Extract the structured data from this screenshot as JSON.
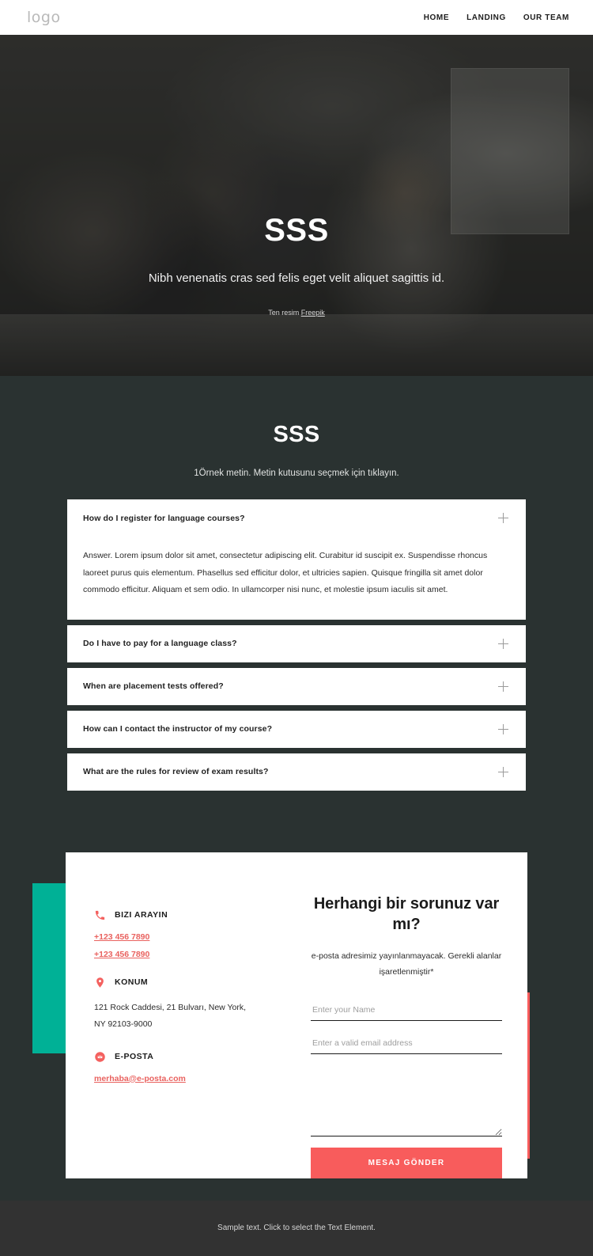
{
  "header": {
    "logo": "logo",
    "nav": [
      {
        "label": "HOME"
      },
      {
        "label": "LANDING"
      },
      {
        "label": "OUR TEAM"
      }
    ]
  },
  "hero": {
    "title": "SSS",
    "subtitle": "Nibh venenatis cras sed felis eget velit aliquet sagittis id.",
    "credit_prefix": "Ten resim ",
    "credit_link": "Freepik"
  },
  "faq": {
    "title": "SSS",
    "subtitle": "1Örnek metin. Metin kutusunu seçmek için tıklayın.",
    "items": [
      {
        "question": "How do I register for language courses?",
        "answer": "Answer. Lorem ipsum dolor sit amet, consectetur adipiscing elit. Curabitur id suscipit ex. Suspendisse rhoncus laoreet purus quis elementum. Phasellus sed efficitur dolor, et ultricies sapien. Quisque fringilla sit amet dolor commodo efficitur. Aliquam et sem odio. In ullamcorper nisi nunc, et molestie ipsum iaculis sit amet.",
        "expanded": true
      },
      {
        "question": "Do I have to pay for a language class?",
        "expanded": false
      },
      {
        "question": "When are placement tests offered?",
        "expanded": false
      },
      {
        "question": "How can I contact the instructor of my course?",
        "expanded": false
      },
      {
        "question": "What are the rules for review of exam results?",
        "expanded": false
      }
    ]
  },
  "contact": {
    "phone": {
      "label": "BIZI ARAYIN",
      "icon": "phone-icon",
      "numbers": [
        "+123 456 7890",
        "+123 456 7890"
      ]
    },
    "location": {
      "label": "KONUM",
      "icon": "map-pin-icon",
      "address": "121 Rock Caddesi, 21 Bulvarı, New York, NY 92103-9000"
    },
    "email": {
      "label": "E-POSTA",
      "icon": "mail-icon",
      "address": "merhaba@e-posta.com"
    },
    "form": {
      "title": "Herhangi bir sorunuz var mı?",
      "note": "e-posta adresimiz yayınlanmayacak. Gerekli alanlar işaretlenmiştir*",
      "name_placeholder": "Enter your Name",
      "email_placeholder": "Enter a valid email address",
      "message_placeholder": "",
      "submit_label": "MESAJ GÖNDER"
    }
  },
  "footer": {
    "text": "Sample text. Click to select the Text Element."
  },
  "colors": {
    "background": "#2a3231",
    "accent_red": "#f85c5c",
    "accent_teal": "#00b196",
    "footer_bg": "#323232",
    "card_bg": "#ffffff"
  }
}
